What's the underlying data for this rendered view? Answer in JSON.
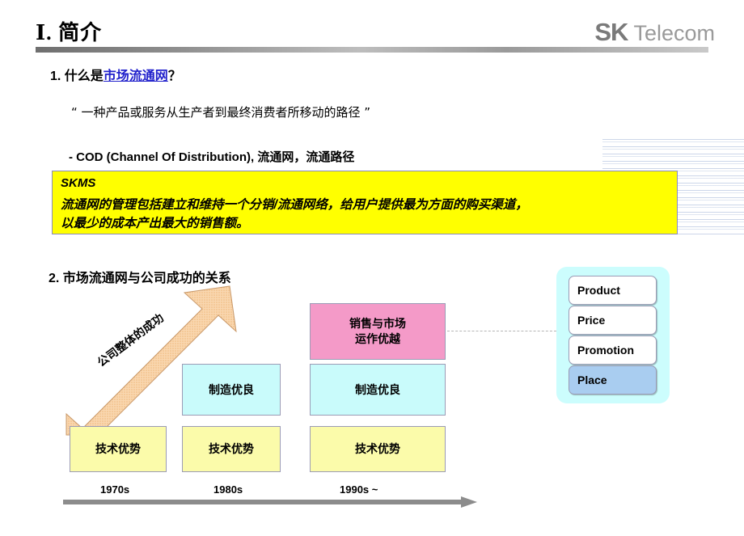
{
  "header": {
    "title": "Ⅰ. 简介",
    "logo_mark": "SK",
    "logo_word": "Telecom"
  },
  "section1": {
    "number_prefix": "1. 什么是",
    "highlight": "市场流通网",
    "suffix": "？",
    "quote": "“ 一种产品或服务从生产者到最终消费者所移动的路径 ”",
    "cod_line": "-  COD (Channel Of Distribution), 流通网，流通路径"
  },
  "skms_box": {
    "title": "SKMS",
    "line1": "流通网的管理包括建立和维持一个分销/流通网络，给用户提供最为方面的购买渠道，",
    "line2": "以最少的成本产出最大的销售额。",
    "bg_color": "#ffff00",
    "border_color": "#8a8ac0"
  },
  "section2": {
    "heading": "2. 市场流通网与公司成功的关系",
    "arrow_label": "公司整体的成功",
    "arrow_color": "#f7cda0",
    "boxes": {
      "sales_market": "销售与市场\n运作优越",
      "sales_market_line1": "销售与市场",
      "sales_market_line2": "运作优越",
      "manufacturing": "制造优良",
      "technology": "技术优势"
    },
    "box_colors": {
      "pink": "#f49ac8",
      "cyan": "#c9fbfb",
      "yellow": "#fbfbaa"
    },
    "timeline": {
      "ticks": [
        "1970s",
        "1980s",
        "1990s ~"
      ],
      "arrow_color": "#8c8c8c"
    }
  },
  "marketing_mix_panel": {
    "panel_color": "#ccfdfd",
    "items": [
      {
        "label": "Product",
        "highlighted": false
      },
      {
        "label": "Price",
        "highlighted": false
      },
      {
        "label": "Promotion",
        "highlighted": false
      },
      {
        "label": "Place",
        "highlighted": true
      }
    ],
    "highlight_color": "#a9cdf0"
  }
}
